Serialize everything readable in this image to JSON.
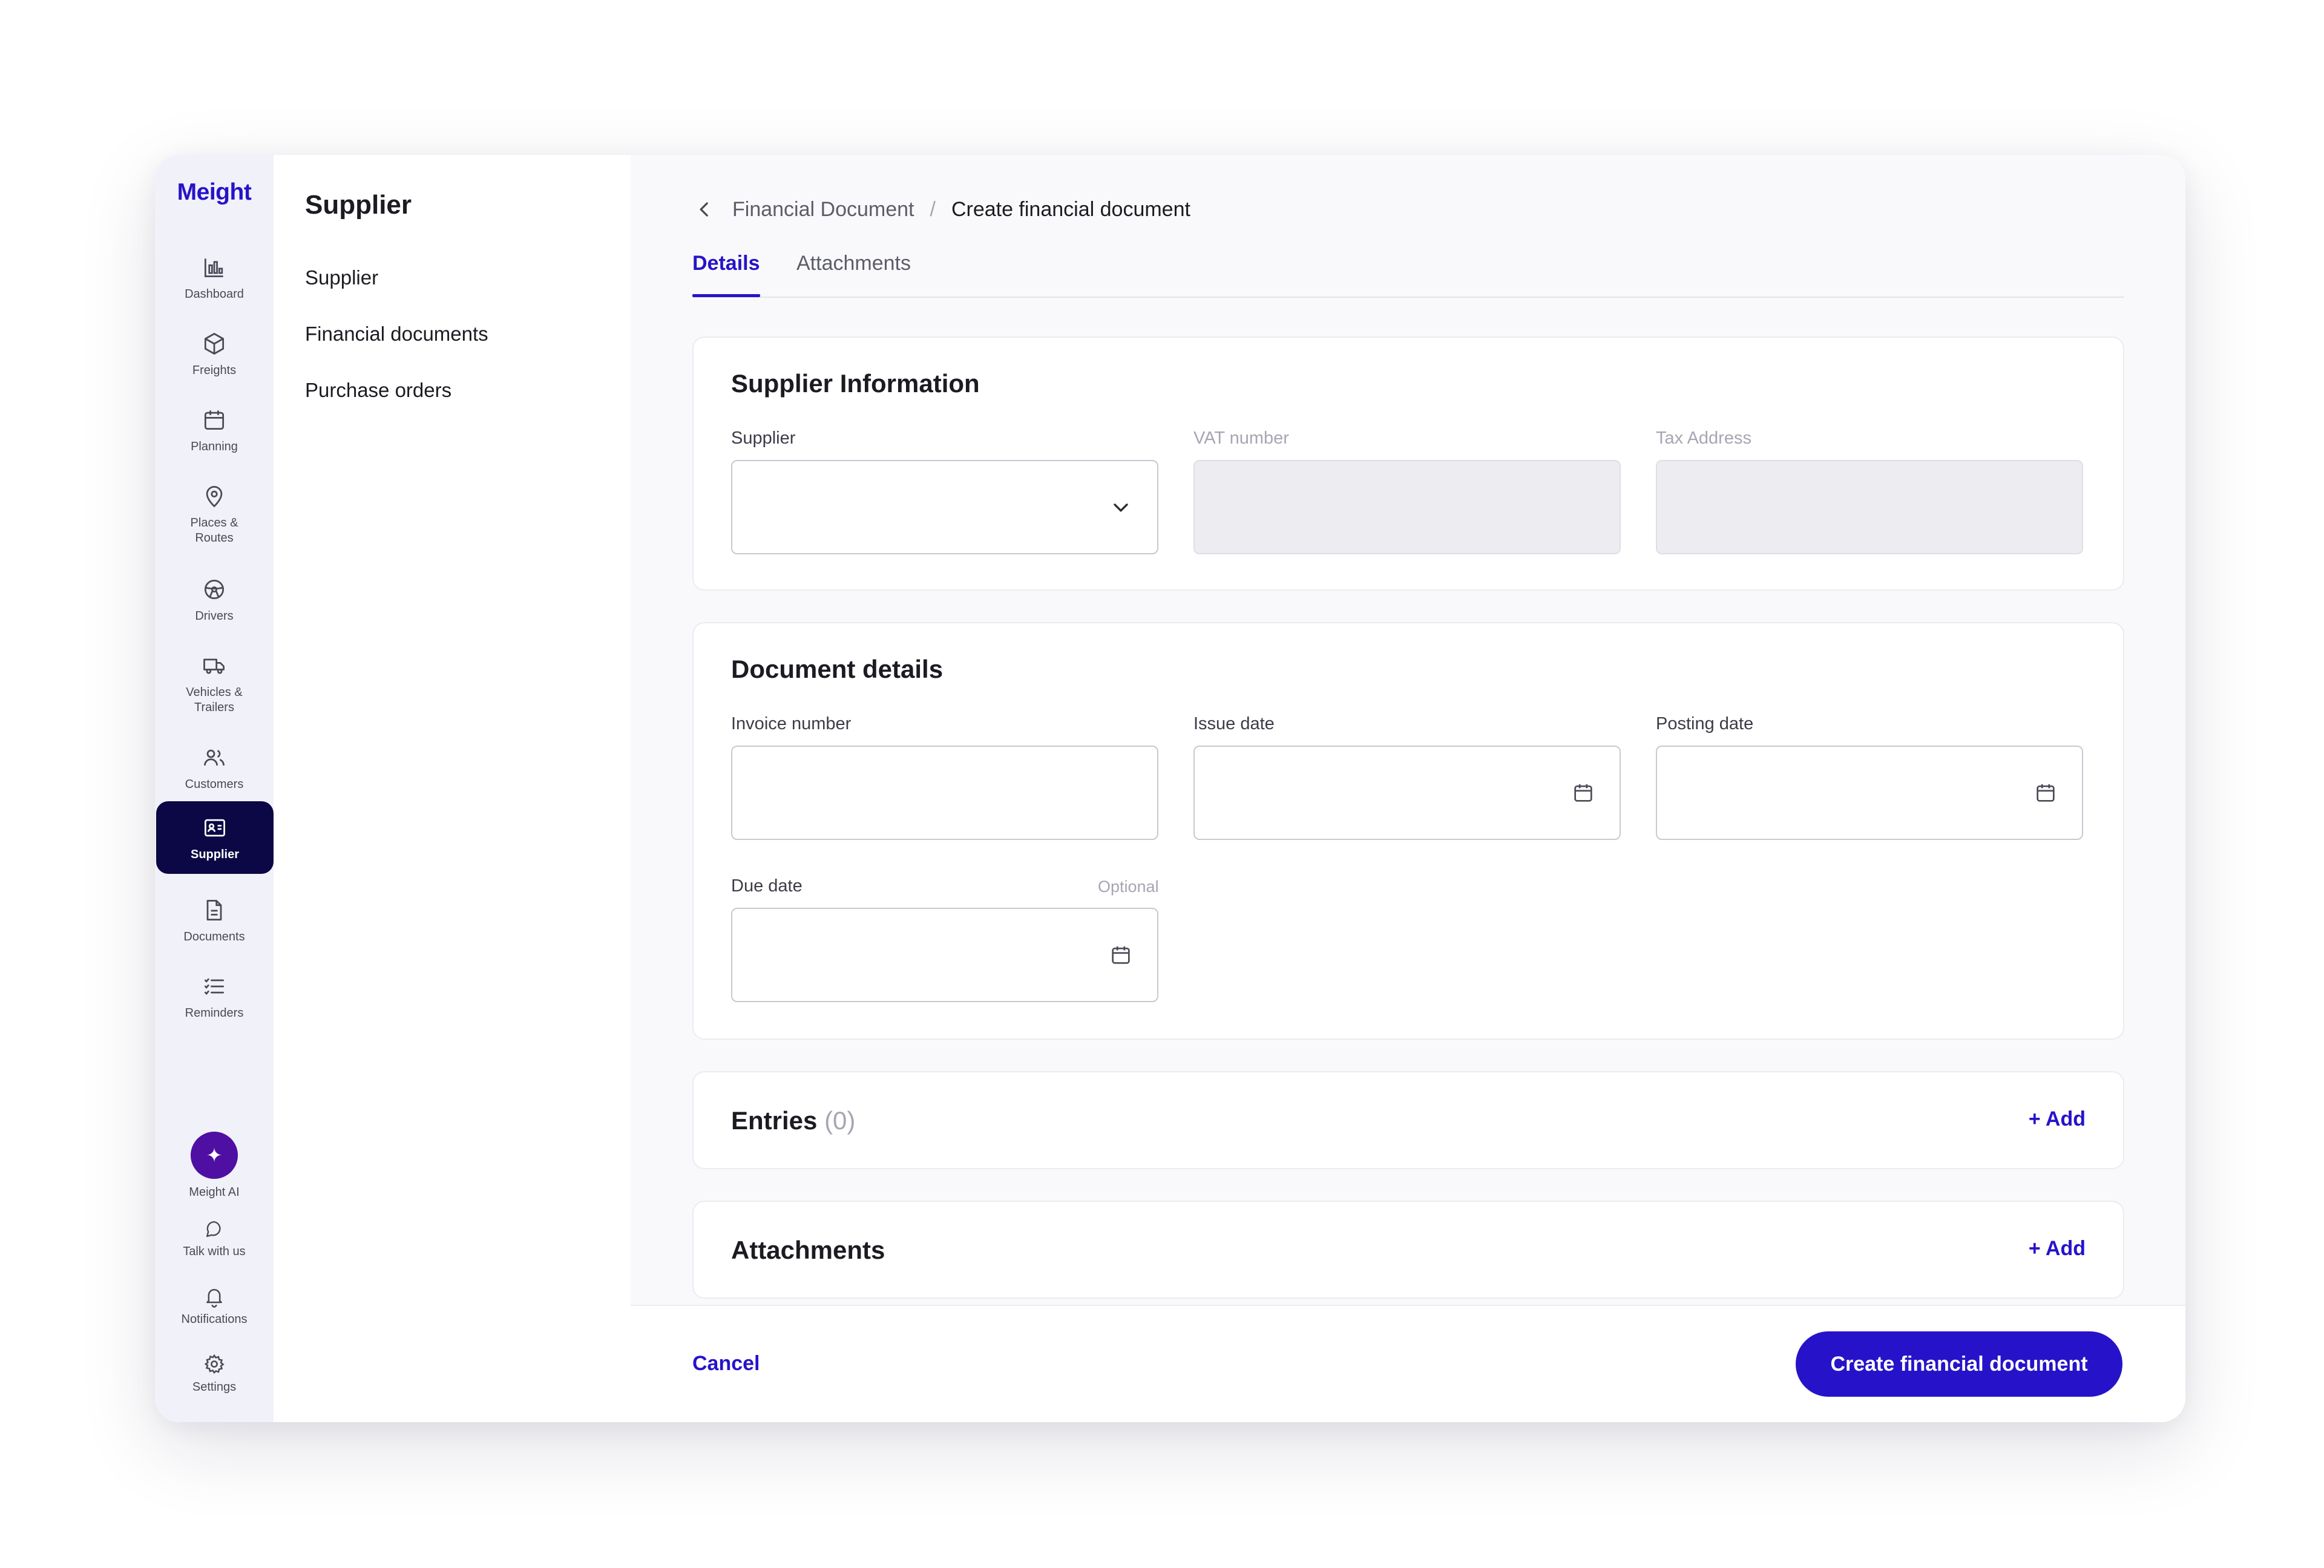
{
  "app": {
    "logo": "Meight"
  },
  "rail": {
    "items": [
      {
        "label": "Dashboard",
        "icon": "dashboard-icon"
      },
      {
        "label": "Freights",
        "icon": "box-icon"
      },
      {
        "label": "Planning",
        "icon": "calendar-icon"
      },
      {
        "label": "Places & Routes",
        "icon": "map-pin-icon"
      },
      {
        "label": "Drivers",
        "icon": "steering-wheel-icon"
      },
      {
        "label": "Vehicles & Trailers",
        "icon": "truck-icon"
      },
      {
        "label": "Customers",
        "icon": "users-icon"
      },
      {
        "label": "Supplier",
        "icon": "id-card-icon",
        "active": true
      },
      {
        "label": "Documents",
        "icon": "document-icon"
      },
      {
        "label": "Reminders",
        "icon": "checklist-icon"
      }
    ],
    "bottom": {
      "ai": "Meight AI",
      "talk": "Talk with us",
      "notifications": "Notifications",
      "settings": "Settings"
    },
    "ai_glyph": "✦"
  },
  "submenu": {
    "title": "Supplier",
    "items": [
      "Supplier",
      "Financial documents",
      "Purchase orders"
    ]
  },
  "breadcrumb": {
    "parent": "Financial Document",
    "separator": "/",
    "current": "Create financial document"
  },
  "tabs": [
    {
      "label": "Details",
      "active": true
    },
    {
      "label": "Attachments",
      "active": false
    }
  ],
  "supplier_info": {
    "title": "Supplier Information",
    "supplier_label": "Supplier",
    "vat_label": "VAT number",
    "tax_label": "Tax Address"
  },
  "document_details": {
    "title": "Document details",
    "invoice_label": "Invoice number",
    "issue_label": "Issue date",
    "posting_label": "Posting date",
    "due_label": "Due date",
    "optional": "Optional"
  },
  "entries": {
    "title": "Entries",
    "count": "(0)",
    "add": "+ Add"
  },
  "attachments": {
    "title": "Attachments",
    "add": "+ Add"
  },
  "footer": {
    "cancel": "Cancel",
    "submit": "Create financial document"
  },
  "colors": {
    "accent": "#2613c9",
    "nav_active": "#0c0845",
    "ai": "#4f0fa3"
  }
}
